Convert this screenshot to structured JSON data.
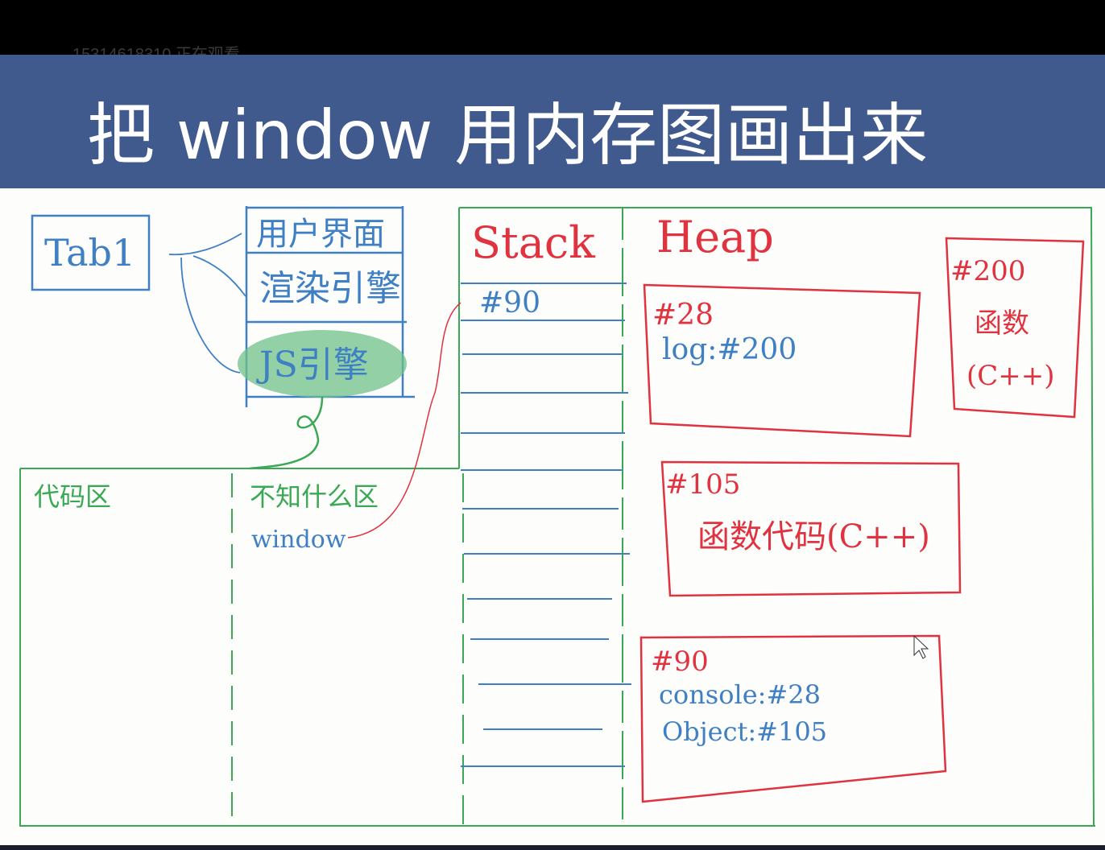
{
  "viewer": {
    "watermark": "15314618310 正在观看"
  },
  "slide": {
    "title": "把 window 用内存图画出来"
  },
  "colors": {
    "header_bg": "#405a8e",
    "blue_ink": "#3f7fc4",
    "green_ink": "#3aa855",
    "red_ink": "#e0333f",
    "highlight": "#6fc08a"
  },
  "diagram": {
    "tab_box": {
      "label": "Tab1"
    },
    "browser_stack": {
      "ui": "用户界面",
      "render_engine": "渲染引擎",
      "js_engine": "JS引擎"
    },
    "memory": {
      "code_area": "代码区",
      "unknown_area": "不知什么区",
      "window_label": "window",
      "stack_title": "Stack",
      "heap_title": "Heap",
      "stack_first_slot": "#90"
    },
    "heap_objects": {
      "console_obj": {
        "address": "#28",
        "field": "log:#200"
      },
      "func_200": {
        "address": "#200",
        "line1": "函数",
        "line2": "(C++)"
      },
      "object_105": {
        "address": "#105",
        "content": "函数代码(C++)"
      },
      "window_90": {
        "address": "#90",
        "field1": "console:#28",
        "field2": "Object:#105"
      }
    }
  }
}
